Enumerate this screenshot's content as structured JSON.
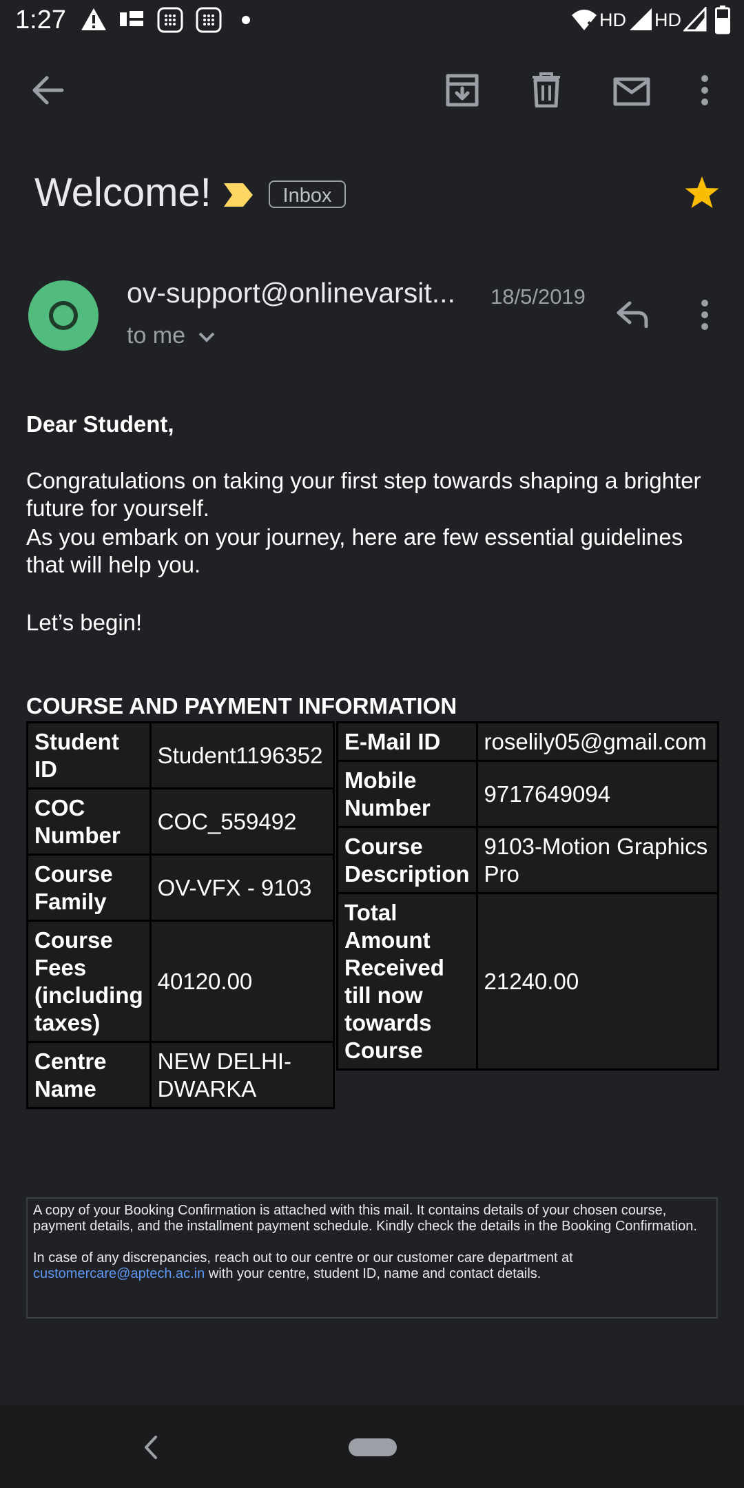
{
  "status_bar": {
    "time": "1:27",
    "network_labels": [
      "HD",
      "HD"
    ]
  },
  "toolbar": {
    "icons": [
      "back-arrow-icon",
      "archive-icon",
      "delete-icon",
      "mark-unread-icon",
      "more-vert-icon"
    ]
  },
  "email": {
    "subject": "Welcome!",
    "label": "Inbox",
    "starred": true,
    "sender": "ov-support@onlinevarsit...",
    "date": "18/5/2019",
    "recipient": "to me",
    "avatar_letter": "O",
    "avatar_color": "#52bb7e"
  },
  "body": {
    "greeting": "Dear Student,",
    "para1": "Congratulations on taking your first step towards shaping a brighter future for yourself.",
    "para2": "As you embark on your journey, here are few essential guidelines that will help you.",
    "para3": "Let’s begin!",
    "section_title": "COURSE AND PAYMENT INFORMATION"
  },
  "table_left": [
    {
      "label": "Student ID",
      "value": "Student1196352"
    },
    {
      "label": "COC Number",
      "value": "COC_559492"
    },
    {
      "label": "Course Family",
      "value": "OV-VFX - 9103"
    },
    {
      "label": "Course Fees (including taxes)",
      "value": "40120.00"
    },
    {
      "label": "Centre Name",
      "value": "NEW DELHI-DWARKA"
    }
  ],
  "table_right": [
    {
      "label": "E-Mail ID",
      "value": "roselily05@gmail.com"
    },
    {
      "label": "Mobile Number",
      "value": "9717649094"
    },
    {
      "label": "Course Description",
      "value": "9103-Motion Graphics Pro"
    },
    {
      "label": "Total Amount Received till now towards Course",
      "value": "21240.00"
    }
  ],
  "footer": {
    "line1": "A copy of your Booking Confirmation is attached with this mail. It contains details of your chosen course, payment details, and the installment payment schedule. Kindly check the details in the Booking Confirmation.",
    "line2_before": "In case of any discrepancies, reach out to our centre or our customer care department at",
    "support_email": "customercare@aptech.ac.in",
    "line2_after": "with your centre, student ID, name and contact details."
  },
  "colors": {
    "background": "#202124",
    "link": "#5e97f6",
    "star": "#fbbc04",
    "important_marker": "#fdd663"
  }
}
